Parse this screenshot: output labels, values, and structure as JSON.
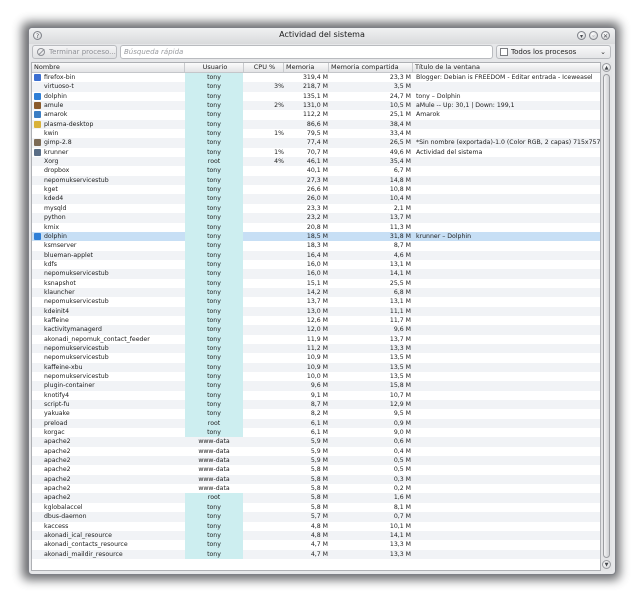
{
  "window": {
    "title": "Actividad del sistema"
  },
  "toolbar": {
    "end_process_label": "Terminar proceso...",
    "search_placeholder": "Búsqueda rápida",
    "filter_label": "Todos los procesos"
  },
  "columns": [
    "Nombre",
    "Usuario",
    "CPU %",
    "Memoria",
    "Memoria compartida",
    "Título de la ventana"
  ],
  "icon_colors": {
    "firefox-icon": "#3b6fd1",
    "terminal-icon": "#5a5f66",
    "dolphin-icon": "#2f7fd6",
    "amule-icon": "#8a5a2b",
    "amarok-icon": "#3c7ec4",
    "plasma-icon": "#d9b23a",
    "gimp-icon": "#7b6a55",
    "krunner-icon": "#5a6e86"
  },
  "processes": [
    {
      "name": "firefox-bin",
      "user": "tony",
      "cpu": "",
      "mem": "319,4 M",
      "shared": "23,3 M",
      "title": "Blogger: Debian is FREEDOM - Editar entrada - Iceweasel",
      "icon": "firefox-icon"
    },
    {
      "name": "virtuoso-t",
      "user": "tony",
      "cpu": "3%",
      "mem": "218,7 M",
      "shared": "3,5 M",
      "title": "",
      "icon": ""
    },
    {
      "name": "dolphin",
      "user": "tony",
      "cpu": "",
      "mem": "135,1 M",
      "shared": "24,7 M",
      "title": "tony – Dolphin",
      "icon": "dolphin-icon"
    },
    {
      "name": "amule",
      "user": "tony",
      "cpu": "2%",
      "mem": "131,0 M",
      "shared": "10,5 M",
      "title": "aMule -- Up: 30,1 | Down: 199,1",
      "icon": "amule-icon"
    },
    {
      "name": "amarok",
      "user": "tony",
      "cpu": "",
      "mem": "112,2 M",
      "shared": "25,1 M",
      "title": "Amarok",
      "icon": "amarok-icon"
    },
    {
      "name": "plasma-desktop",
      "user": "tony",
      "cpu": "",
      "mem": "86,6 M",
      "shared": "38,4 M",
      "title": "",
      "icon": "plasma-icon"
    },
    {
      "name": "kwin",
      "user": "tony",
      "cpu": "1%",
      "mem": "79,5 M",
      "shared": "33,4 M",
      "title": "",
      "icon": ""
    },
    {
      "name": "gimp-2.8",
      "user": "tony",
      "cpu": "",
      "mem": "77,4 M",
      "shared": "26,5 M",
      "title": "*Sin nombre (exportada)-1.0 (Color RGB, 2 capas) 715x757",
      "icon": "gimp-icon"
    },
    {
      "name": "krunner",
      "user": "tony",
      "cpu": "1%",
      "mem": "70,7 M",
      "shared": "49,6 M",
      "title": "Actividad del sistema",
      "icon": "krunner-icon"
    },
    {
      "name": "Xorg",
      "user": "root",
      "cpu": "4%",
      "mem": "46,1 M",
      "shared": "35,4 M",
      "title": "",
      "icon": ""
    },
    {
      "name": "dropbox",
      "user": "tony",
      "cpu": "",
      "mem": "40,1 M",
      "shared": "6,7 M",
      "title": "",
      "icon": ""
    },
    {
      "name": "nepomukservicestub",
      "user": "tony",
      "cpu": "",
      "mem": "27,3 M",
      "shared": "14,8 M",
      "title": "",
      "icon": ""
    },
    {
      "name": "kget",
      "user": "tony",
      "cpu": "",
      "mem": "26,6 M",
      "shared": "10,8 M",
      "title": "",
      "icon": ""
    },
    {
      "name": "kded4",
      "user": "tony",
      "cpu": "",
      "mem": "26,0 M",
      "shared": "10,4 M",
      "title": "",
      "icon": ""
    },
    {
      "name": "mysqld",
      "user": "tony",
      "cpu": "",
      "mem": "23,3 M",
      "shared": "2,1 M",
      "title": "",
      "icon": ""
    },
    {
      "name": "python",
      "user": "tony",
      "cpu": "",
      "mem": "23,2 M",
      "shared": "13,7 M",
      "title": "",
      "icon": ""
    },
    {
      "name": "kmix",
      "user": "tony",
      "cpu": "",
      "mem": "20,8 M",
      "shared": "11,3 M",
      "title": "",
      "icon": ""
    },
    {
      "name": "dolphin",
      "user": "tony",
      "cpu": "",
      "mem": "18,5 M",
      "shared": "31,8 M",
      "title": "krunner – Dolphin",
      "icon": "dolphin-icon",
      "selected": true
    },
    {
      "name": "ksmserver",
      "user": "tony",
      "cpu": "",
      "mem": "18,3 M",
      "shared": "8,7 M",
      "title": "",
      "icon": ""
    },
    {
      "name": "blueman-applet",
      "user": "tony",
      "cpu": "",
      "mem": "16,4 M",
      "shared": "4,6 M",
      "title": "",
      "icon": ""
    },
    {
      "name": "kdfs",
      "user": "tony",
      "cpu": "",
      "mem": "16,0 M",
      "shared": "13,1 M",
      "title": "",
      "icon": ""
    },
    {
      "name": "nepomukservicestub",
      "user": "tony",
      "cpu": "",
      "mem": "16,0 M",
      "shared": "14,1 M",
      "title": "",
      "icon": ""
    },
    {
      "name": "ksnapshot",
      "user": "tony",
      "cpu": "",
      "mem": "15,1 M",
      "shared": "25,5 M",
      "title": "",
      "icon": ""
    },
    {
      "name": "klauncher",
      "user": "tony",
      "cpu": "",
      "mem": "14,2 M",
      "shared": "6,8 M",
      "title": "",
      "icon": ""
    },
    {
      "name": "nepomukservicestub",
      "user": "tony",
      "cpu": "",
      "mem": "13,7 M",
      "shared": "13,1 M",
      "title": "",
      "icon": ""
    },
    {
      "name": "kdeinit4",
      "user": "tony",
      "cpu": "",
      "mem": "13,0 M",
      "shared": "11,1 M",
      "title": "",
      "icon": ""
    },
    {
      "name": "kaffeine",
      "user": "tony",
      "cpu": "",
      "mem": "12,6 M",
      "shared": "11,7 M",
      "title": "",
      "icon": ""
    },
    {
      "name": "kactivitymanagerd",
      "user": "tony",
      "cpu": "",
      "mem": "12,0 M",
      "shared": "9,6 M",
      "title": "",
      "icon": ""
    },
    {
      "name": "akonadi_nepomuk_contact_feeder",
      "user": "tony",
      "cpu": "",
      "mem": "11,9 M",
      "shared": "13,7 M",
      "title": "",
      "icon": ""
    },
    {
      "name": "nepomukservicestub",
      "user": "tony",
      "cpu": "",
      "mem": "11,2 M",
      "shared": "13,3 M",
      "title": "",
      "icon": ""
    },
    {
      "name": "nepomukservicestub",
      "user": "tony",
      "cpu": "",
      "mem": "10,9 M",
      "shared": "13,5 M",
      "title": "",
      "icon": ""
    },
    {
      "name": "kaffeine-xbu",
      "user": "tony",
      "cpu": "",
      "mem": "10,9 M",
      "shared": "13,5 M",
      "title": "",
      "icon": ""
    },
    {
      "name": "nepomukservicestub",
      "user": "tony",
      "cpu": "",
      "mem": "10,0 M",
      "shared": "13,5 M",
      "title": "",
      "icon": ""
    },
    {
      "name": "plugin-container",
      "user": "tony",
      "cpu": "",
      "mem": "9,6 M",
      "shared": "15,8 M",
      "title": "",
      "icon": ""
    },
    {
      "name": "knotify4",
      "user": "tony",
      "cpu": "",
      "mem": "9,1 M",
      "shared": "10,7 M",
      "title": "",
      "icon": ""
    },
    {
      "name": "script-fu",
      "user": "tony",
      "cpu": "",
      "mem": "8,7 M",
      "shared": "12,9 M",
      "title": "",
      "icon": ""
    },
    {
      "name": "yakuake",
      "user": "tony",
      "cpu": "",
      "mem": "8,2 M",
      "shared": "9,5 M",
      "title": "",
      "icon": ""
    },
    {
      "name": "preload",
      "user": "root",
      "cpu": "",
      "mem": "6,1 M",
      "shared": "0,9 M",
      "title": "",
      "icon": ""
    },
    {
      "name": "korgac",
      "user": "tony",
      "cpu": "",
      "mem": "6,1 M",
      "shared": "9,0 M",
      "title": "",
      "icon": ""
    },
    {
      "name": "apache2",
      "user": "www-data",
      "cpu": "",
      "mem": "5,9 M",
      "shared": "0,6 M",
      "title": "",
      "icon": ""
    },
    {
      "name": "apache2",
      "user": "www-data",
      "cpu": "",
      "mem": "5,9 M",
      "shared": "0,4 M",
      "title": "",
      "icon": ""
    },
    {
      "name": "apache2",
      "user": "www-data",
      "cpu": "",
      "mem": "5,9 M",
      "shared": "0,5 M",
      "title": "",
      "icon": ""
    },
    {
      "name": "apache2",
      "user": "www-data",
      "cpu": "",
      "mem": "5,8 M",
      "shared": "0,5 M",
      "title": "",
      "icon": ""
    },
    {
      "name": "apache2",
      "user": "www-data",
      "cpu": "",
      "mem": "5,8 M",
      "shared": "0,3 M",
      "title": "",
      "icon": ""
    },
    {
      "name": "apache2",
      "user": "www-data",
      "cpu": "",
      "mem": "5,8 M",
      "shared": "0,2 M",
      "title": "",
      "icon": ""
    },
    {
      "name": "apache2",
      "user": "root",
      "cpu": "",
      "mem": "5,8 M",
      "shared": "1,6 M",
      "title": "",
      "icon": ""
    },
    {
      "name": "kglobalaccel",
      "user": "tony",
      "cpu": "",
      "mem": "5,8 M",
      "shared": "8,1 M",
      "title": "",
      "icon": ""
    },
    {
      "name": "dbus-daemon",
      "user": "tony",
      "cpu": "",
      "mem": "5,7 M",
      "shared": "0,7 M",
      "title": "",
      "icon": ""
    },
    {
      "name": "kaccess",
      "user": "tony",
      "cpu": "",
      "mem": "4,8 M",
      "shared": "10,1 M",
      "title": "",
      "icon": ""
    },
    {
      "name": "akonadi_ical_resource",
      "user": "tony",
      "cpu": "",
      "mem": "4,8 M",
      "shared": "14,1 M",
      "title": "",
      "icon": ""
    },
    {
      "name": "akonadi_contacts_resource",
      "user": "tony",
      "cpu": "",
      "mem": "4,7 M",
      "shared": "13,3 M",
      "title": "",
      "icon": ""
    },
    {
      "name": "akonadi_maildir_resource",
      "user": "tony",
      "cpu": "",
      "mem": "4,7 M",
      "shared": "13,3 M",
      "title": "",
      "icon": ""
    }
  ]
}
